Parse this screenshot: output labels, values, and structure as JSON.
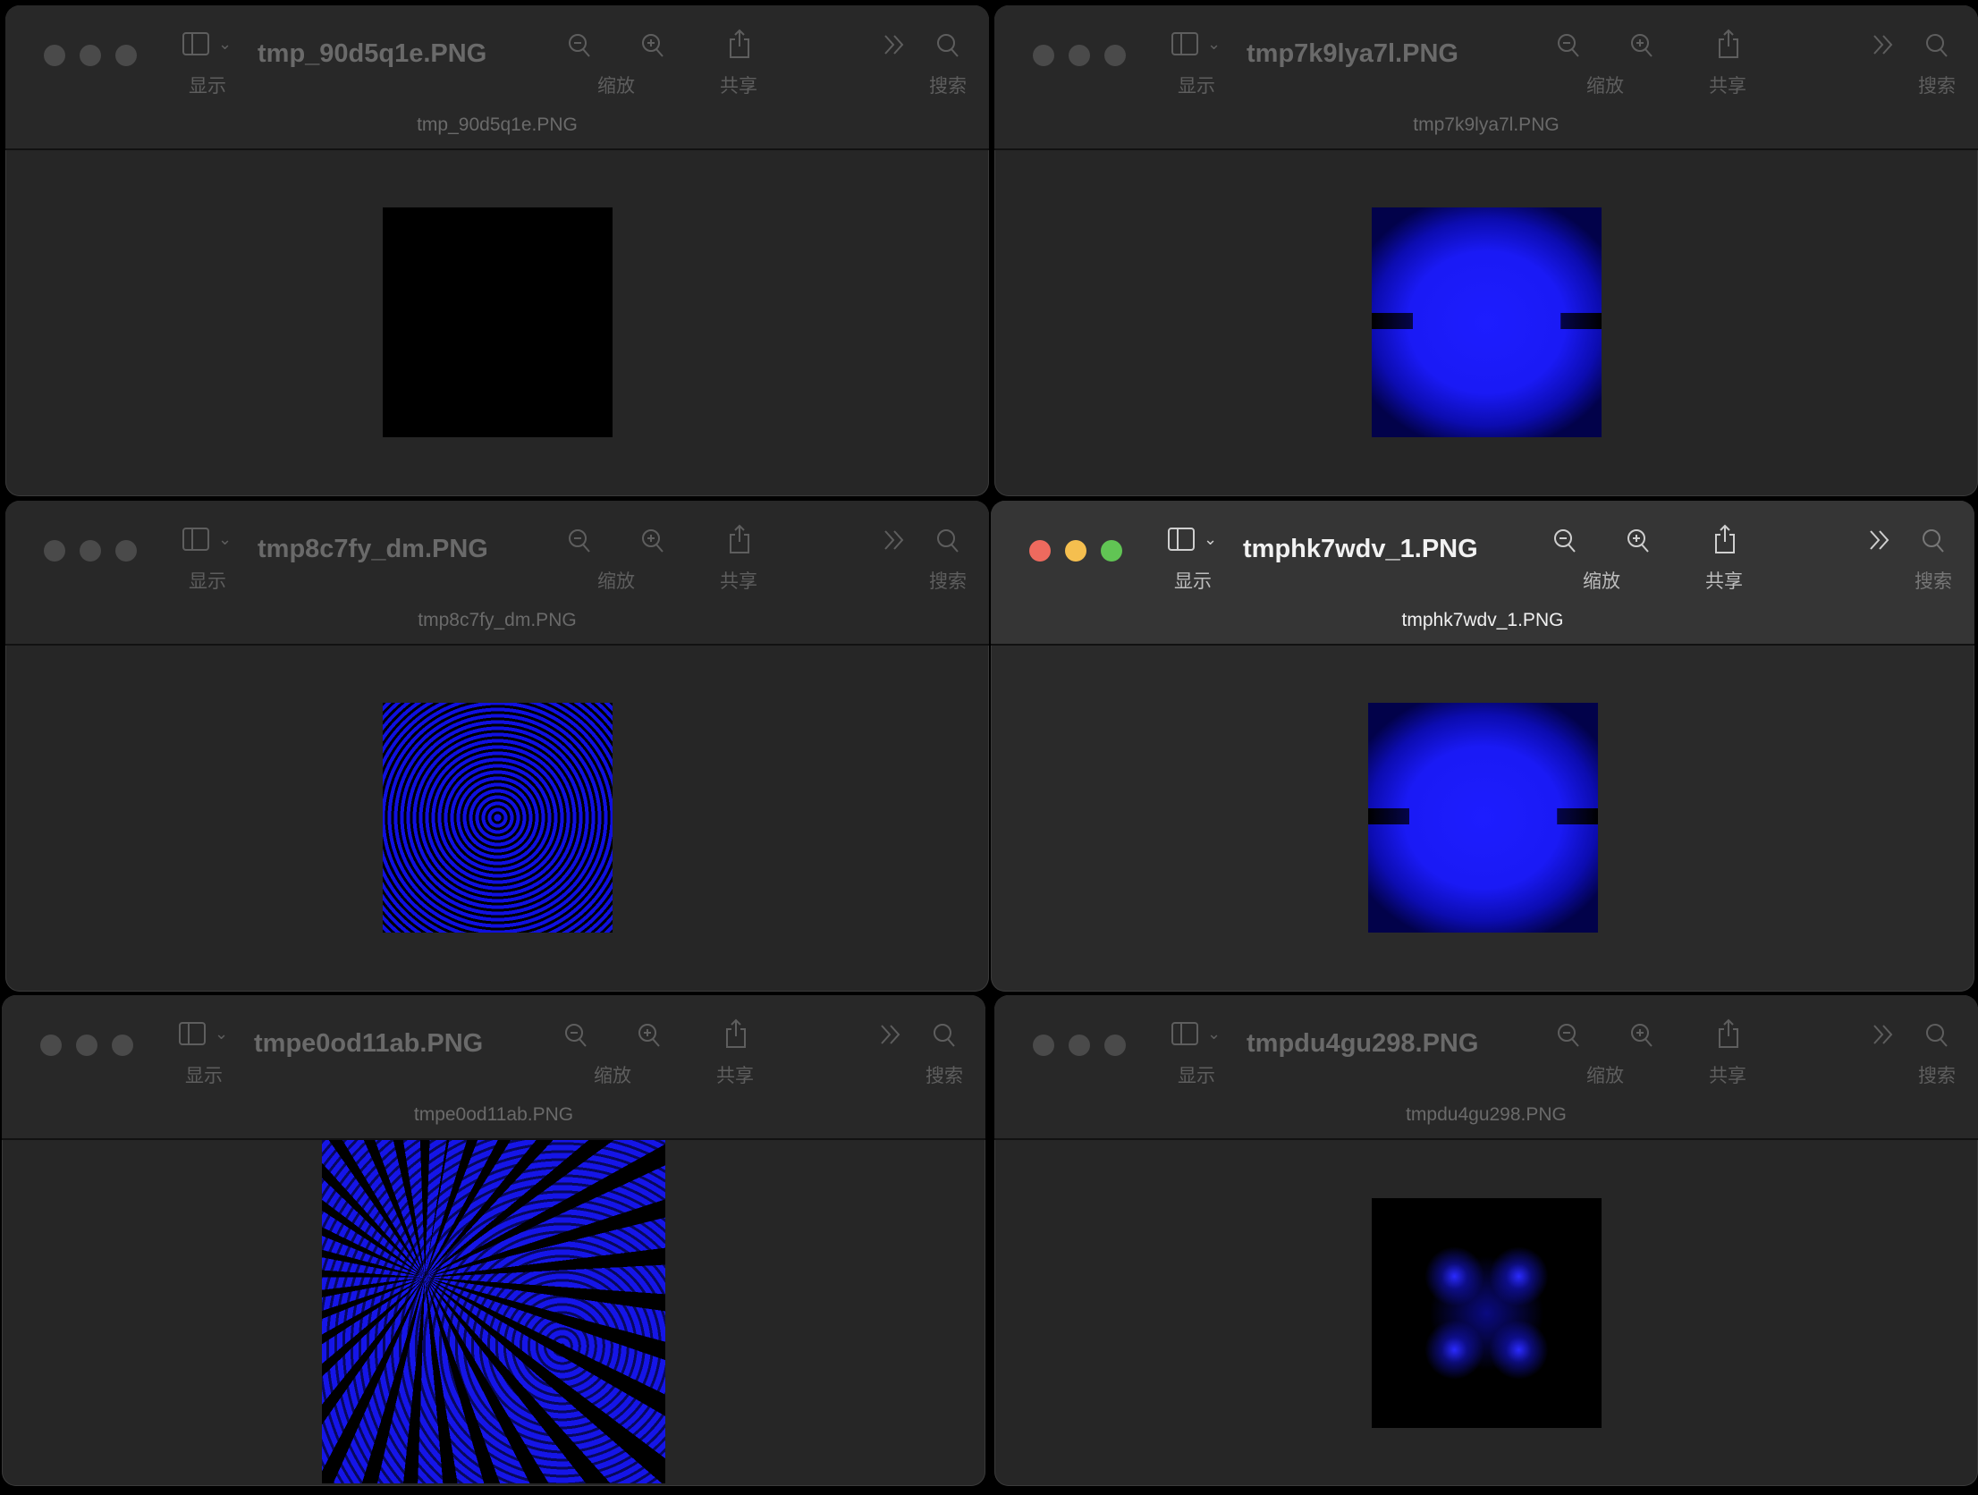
{
  "toolbar": {
    "view_label": "显示",
    "zoom_label": "缩放",
    "share_label": "共享",
    "search_label": "搜索"
  },
  "windows": [
    {
      "title": "tmp_90d5q1e.PNG",
      "subtitle": "tmp_90d5q1e.PNG",
      "active": false
    },
    {
      "title": "tmp7k9lya7l.PNG",
      "subtitle": "tmp7k9lya7l.PNG",
      "active": false
    },
    {
      "title": "tmp8c7fy_dm.PNG",
      "subtitle": "tmp8c7fy_dm.PNG",
      "active": false
    },
    {
      "title": "tmphk7wdv_1.PNG",
      "subtitle": "tmphk7wdv_1.PNG",
      "active": true
    },
    {
      "title": "tmpe0od11ab.PNG",
      "subtitle": "tmpe0od11ab.PNG",
      "active": false
    },
    {
      "title": "tmpdu4gu298.PNG",
      "subtitle": "tmpdu4gu298.PNG",
      "active": false
    }
  ],
  "colors": {
    "accent_image_blue": "#1d1dff",
    "close": "#ee6a5e",
    "minimize": "#f5bf4f",
    "zoom": "#61c554"
  }
}
